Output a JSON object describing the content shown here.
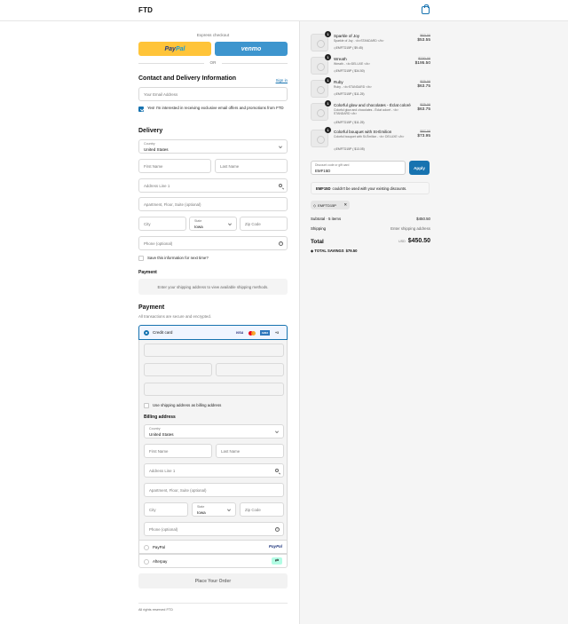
{
  "header": {
    "brand": "FTD",
    "cart_icon": "shopping-bag-icon"
  },
  "express": {
    "label": "Express checkout",
    "paypal_pay": "Pay",
    "paypal_pal": "Pal",
    "venmo": "venmo",
    "or": "OR"
  },
  "contact": {
    "title": "Contact and Delivery Information",
    "sign_in": "Sign in",
    "email_placeholder": "Your Email Address",
    "offers_label": "Yes! I'm interested in receiving exclusive email offers and promotions from FTD"
  },
  "delivery": {
    "title": "Delivery",
    "country_label": "Country",
    "country_value": "United States",
    "first_name": "First Name",
    "last_name": "Last Name",
    "address1": "Address Line 1",
    "address2": "Apartment, Floor, Suite (optional)",
    "city": "City",
    "state_label": "State",
    "state_value": "Iowa",
    "zip": "Zip Code",
    "phone": "Phone (optional)",
    "save_info": "Save this information for next time?"
  },
  "shipping_method": {
    "title": "Payment",
    "info": "Enter your shipping address to view available shipping methods."
  },
  "payment": {
    "title": "Payment",
    "subtitle": "All transactions are secure and encrypted.",
    "credit_card": "Credit card",
    "visa": "VISA",
    "amex": "AMEX",
    "more_cards": "+3",
    "use_shipping": "Use shipping address as billing address",
    "billing_title": "Billing address",
    "paypal_label": "PayPal",
    "paypal_logo": "PayPal",
    "afterpay_label": "Afterpay",
    "afterpay_logo": "⇄"
  },
  "billing": {
    "country_label": "Country",
    "country_value": "United States",
    "first_name": "First Name",
    "last_name": "Last Name",
    "address1": "Address Line 1",
    "address2": "Apartment, Floor, Suite (optional)",
    "city": "City",
    "state_label": "State",
    "state_value": "Iowa",
    "zip": "Zip Code",
    "phone": "Phone (optional)"
  },
  "place_order": "Place Your Order",
  "footer": {
    "rights": "All rights reserved FTD"
  },
  "cart": {
    "items": [
      {
        "qty": "1",
        "name": "Sparkle of Joy",
        "variant": "Sparkle of Joy - <b>STANDARD </b>",
        "code": "EMFTD15P ( $9.45)",
        "old": "$63.00",
        "price": "$53.55"
      },
      {
        "qty": "1",
        "name": "Wreath",
        "variant": "Wreath - <b>DELUXE </b>",
        "code": "EMFTD15P ( $34.50)",
        "old": "$230.00",
        "price": "$195.50"
      },
      {
        "qty": "1",
        "name": "Ruby",
        "variant": "Ruby - <b>STANDARD </b>",
        "code": "EMFTD15P ( $11.25)",
        "old": "$75.00",
        "price": "$63.75"
      },
      {
        "qty": "1",
        "name": "Colorful glow and chocolates - Éclat coloré",
        "variant": "Colorful glow and chocolates - Éclat coloré - <b> STANDARD </b>",
        "code": "EMFTD15P ( $11.25)",
        "old": "$75.00",
        "price": "$63.75"
      },
      {
        "qty": "1",
        "name": "Colorful bouquet with St-Émilion",
        "variant": "Colorful bouquet with St-Émilion - <b> DELUXE </b>",
        "code": "EMFTD15P ( $13.05)",
        "old": "$87.00",
        "price": "$73.95"
      }
    ],
    "discount_label": "Discount code or gift card",
    "discount_value": "EMF15D",
    "apply": "Apply",
    "error_code": "EMF15D",
    "error_text": "couldn't be used with your existing discounts.",
    "applied_code": "EMFTD15P",
    "remove": "✕",
    "subtotal_label": "Subtotal · 5 items",
    "subtotal_value": "$450.50",
    "shipping_label": "Shipping",
    "shipping_value": "Enter shipping address",
    "total_label": "Total",
    "currency": "USD",
    "total_value": "$450.50",
    "savings_label": "TOTAL SAVINGS",
    "savings_value": "$79.50"
  }
}
